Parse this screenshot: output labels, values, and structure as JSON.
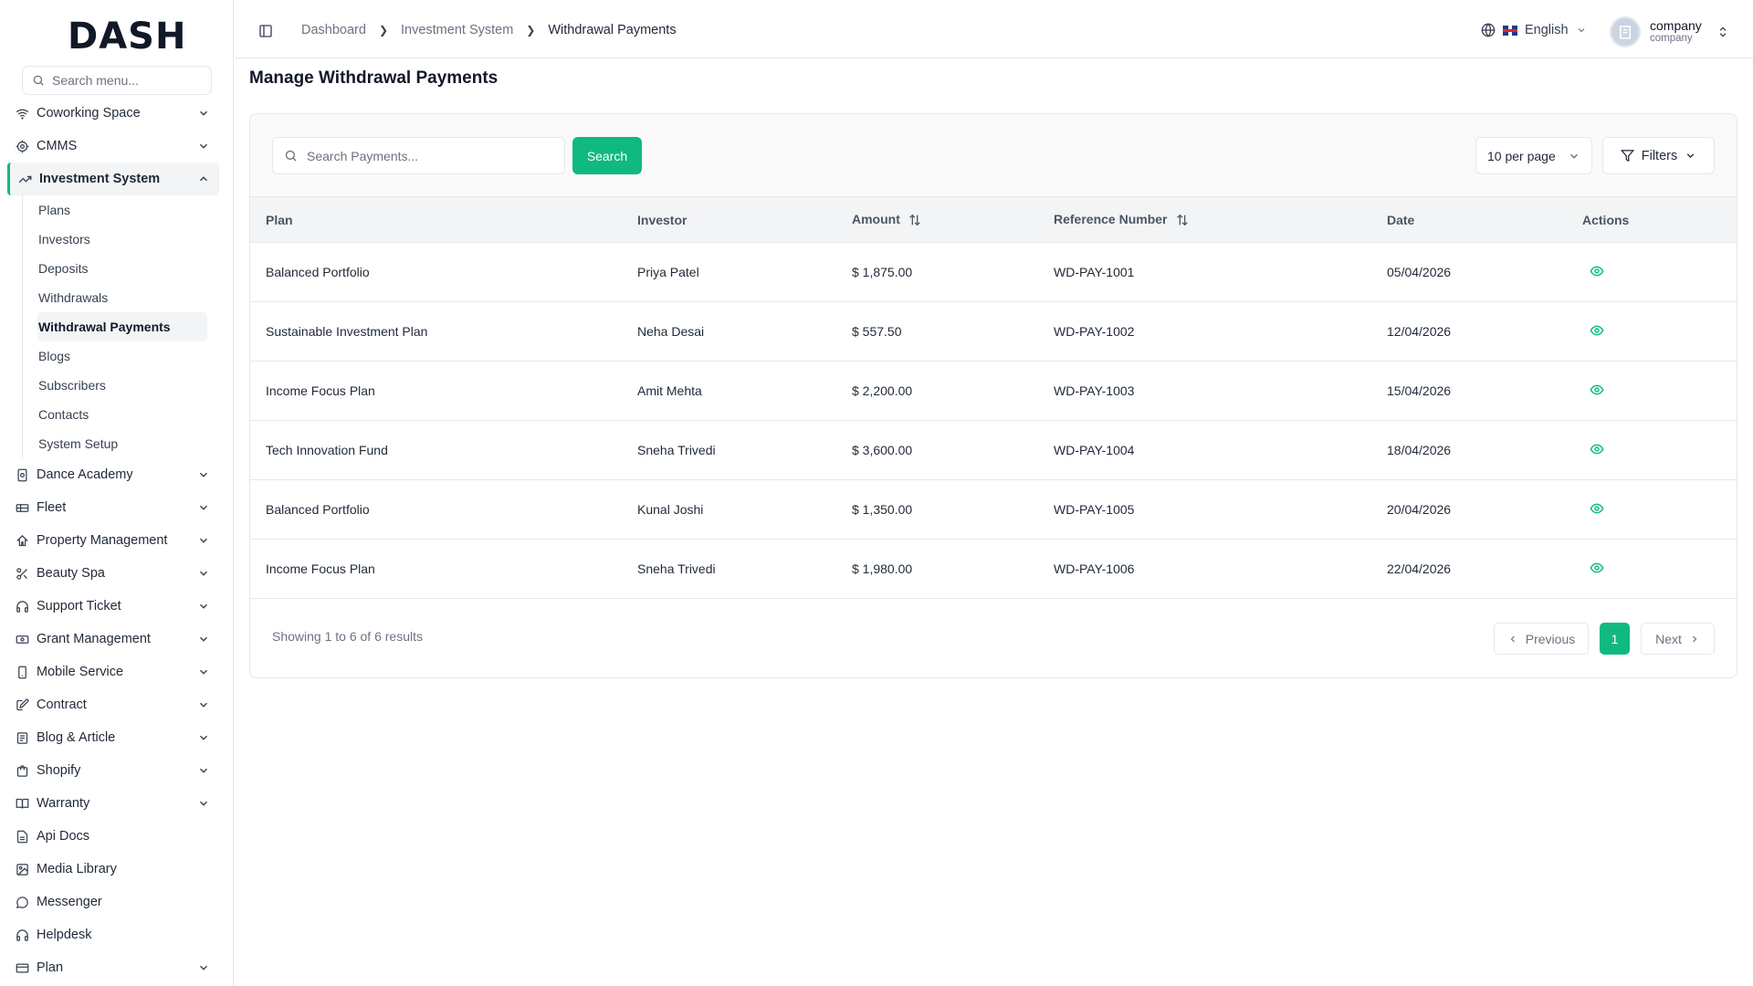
{
  "app": {
    "logo": "DASH"
  },
  "sidebar": {
    "search_placeholder": "Search menu...",
    "items_top": [
      {
        "label": "Coworking Space",
        "icon": "wifi-icon"
      },
      {
        "label": "CMMS",
        "icon": "cog-icon"
      }
    ],
    "active": {
      "label": "Investment System",
      "icon": "trending-up-icon"
    },
    "sub_items": [
      "Plans",
      "Investors",
      "Deposits",
      "Withdrawals",
      "Withdrawal Payments",
      "Blogs",
      "Subscribers",
      "Contacts",
      "System Setup"
    ],
    "current_sub": "Withdrawal Payments",
    "items_bottom": [
      {
        "label": "Dance Academy",
        "icon": "building-icon",
        "chevron": true
      },
      {
        "label": "Fleet",
        "icon": "car-icon",
        "chevron": true
      },
      {
        "label": "Property Management",
        "icon": "home-icon",
        "chevron": true
      },
      {
        "label": "Beauty Spa",
        "icon": "scissors-icon",
        "chevron": true
      },
      {
        "label": "Support Ticket",
        "icon": "headphones-icon",
        "chevron": true
      },
      {
        "label": "Grant Management",
        "icon": "banknote-icon",
        "chevron": true
      },
      {
        "label": "Mobile Service",
        "icon": "smartphone-icon",
        "chevron": true
      },
      {
        "label": "Contract",
        "icon": "pen-icon",
        "chevron": true
      },
      {
        "label": "Blog & Article",
        "icon": "newspaper-icon",
        "chevron": true
      },
      {
        "label": "Shopify",
        "icon": "shopping-bag-icon",
        "chevron": true
      },
      {
        "label": "Warranty",
        "icon": "book-open-icon",
        "chevron": true
      },
      {
        "label": "Api Docs",
        "icon": "file-text-icon",
        "chevron": false
      },
      {
        "label": "Media Library",
        "icon": "image-icon",
        "chevron": false
      },
      {
        "label": "Messenger",
        "icon": "message-circle-icon",
        "chevron": false
      },
      {
        "label": "Helpdesk",
        "icon": "headset-icon",
        "chevron": false
      },
      {
        "label": "Plan",
        "icon": "credit-card-icon",
        "chevron": true
      }
    ]
  },
  "header": {
    "breadcrumb": [
      "Dashboard",
      "Investment System",
      "Withdrawal Payments"
    ],
    "language": "English",
    "user_name": "company",
    "user_role": "company"
  },
  "main": {
    "title": "Manage Withdrawal Payments",
    "search_placeholder": "Search Payments...",
    "search_button": "Search",
    "per_page": "10 per page",
    "filters": "Filters",
    "columns": [
      "Plan",
      "Investor",
      "Amount",
      "Reference Number",
      "Date",
      "Actions"
    ],
    "rows": [
      {
        "plan": "Balanced Portfolio",
        "investor": "Priya Patel",
        "amount": "$ 1,875.00",
        "ref": "WD-PAY-1001",
        "date": "05/04/2026"
      },
      {
        "plan": "Sustainable Investment Plan",
        "investor": "Neha Desai",
        "amount": "$ 557.50",
        "ref": "WD-PAY-1002",
        "date": "12/04/2026"
      },
      {
        "plan": "Income Focus Plan",
        "investor": "Amit Mehta",
        "amount": "$ 2,200.00",
        "ref": "WD-PAY-1003",
        "date": "15/04/2026"
      },
      {
        "plan": "Tech Innovation Fund",
        "investor": "Sneha Trivedi",
        "amount": "$ 3,600.00",
        "ref": "WD-PAY-1004",
        "date": "18/04/2026"
      },
      {
        "plan": "Balanced Portfolio",
        "investor": "Kunal Joshi",
        "amount": "$ 1,350.00",
        "ref": "WD-PAY-1005",
        "date": "20/04/2026"
      },
      {
        "plan": "Income Focus Plan",
        "investor": "Sneha Trivedi",
        "amount": "$ 1,980.00",
        "ref": "WD-PAY-1006",
        "date": "22/04/2026"
      }
    ],
    "showing": "Showing 1 to 6 of 6 results",
    "previous": "Previous",
    "page": "1",
    "next": "Next"
  },
  "colors": {
    "accent": "#10b981",
    "border": "#e5e7eb"
  }
}
